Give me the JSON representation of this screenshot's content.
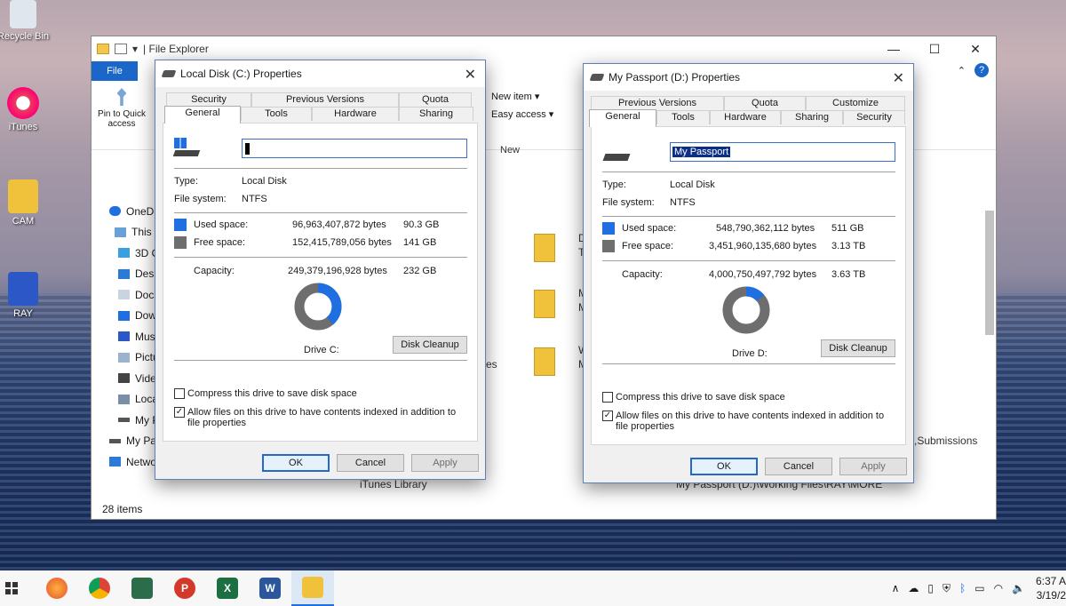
{
  "desktop": {
    "icons": [
      "Recycle Bin",
      "iTunes",
      "CAM",
      "RAY"
    ]
  },
  "explorer": {
    "title": "| File Explorer",
    "file_tab": "File",
    "ribbon": {
      "pin_label": "Pin to Quick access",
      "new_item": "New item ▾",
      "easy_access": "Easy access ▾",
      "new_group": "New"
    },
    "nav": [
      "OneD",
      "This P",
      "3D O",
      "Desk",
      "Doc",
      "Dow",
      "Mus",
      "Pictu",
      "Vide",
      "Loca",
      "My P",
      "My Pa",
      "Network"
    ],
    "fragments": {
      "d1": "D",
      "t1": "T",
      "m1": "M",
      "m2": "M",
      "w1": "W",
      "m3": "M",
      "res": "res",
      "submissions": ",Submissions",
      "itunes_library": "iTunes Library",
      "path": "My Passport (D:)\\Working Files\\RAY\\MORE"
    },
    "status": "28 items"
  },
  "dialog_c": {
    "title": "Local Disk (C:) Properties",
    "tabs_top": [
      "Security",
      "Previous Versions",
      "Quota"
    ],
    "tabs_bottom": [
      "General",
      "Tools",
      "Hardware",
      "Sharing"
    ],
    "type_label": "Type:",
    "type_value": "Local Disk",
    "fs_label": "File system:",
    "fs_value": "NTFS",
    "used_label": "Used space:",
    "used_bytes": "96,963,407,872 bytes",
    "used_gb": "90.3 GB",
    "free_label": "Free space:",
    "free_bytes": "152,415,789,056 bytes",
    "free_gb": "141 GB",
    "cap_label": "Capacity:",
    "cap_bytes": "249,379,196,928 bytes",
    "cap_gb": "232 GB",
    "used_fraction": 0.389,
    "drive_label": "Drive C:",
    "cleanup": "Disk Cleanup",
    "compress": "Compress this drive to save disk space",
    "index": "Allow files on this drive to have contents indexed in addition to file properties",
    "ok": "OK",
    "cancel": "Cancel",
    "apply": "Apply"
  },
  "dialog_d": {
    "title": "My Passport (D:) Properties",
    "tabs_top": [
      "Previous Versions",
      "Quota",
      "Customize"
    ],
    "tabs_bottom": [
      "General",
      "Tools",
      "Hardware",
      "Sharing",
      "Security"
    ],
    "name_value": "My Passport",
    "type_label": "Type:",
    "type_value": "Local Disk",
    "fs_label": "File system:",
    "fs_value": "NTFS",
    "used_label": "Used space:",
    "used_bytes": "548,790,362,112 bytes",
    "used_gb": "511 GB",
    "free_label": "Free space:",
    "free_bytes": "3,451,960,135,680 bytes",
    "free_gb": "3.13 TB",
    "cap_label": "Capacity:",
    "cap_bytes": "4,000,750,497,792 bytes",
    "cap_gb": "3.63 TB",
    "used_fraction": 0.137,
    "drive_label": "Drive D:",
    "cleanup": "Disk Cleanup",
    "compress": "Compress this drive to save disk space",
    "index": "Allow files on this drive to have contents indexed in addition to file properties",
    "ok": "OK",
    "cancel": "Cancel",
    "apply": "Apply"
  },
  "taskbar": {
    "time": "6:37 A",
    "date": "3/19/2"
  },
  "colors": {
    "used": "#1f6fe0",
    "free": "#6e6e6e",
    "accent": "#2469c5"
  }
}
